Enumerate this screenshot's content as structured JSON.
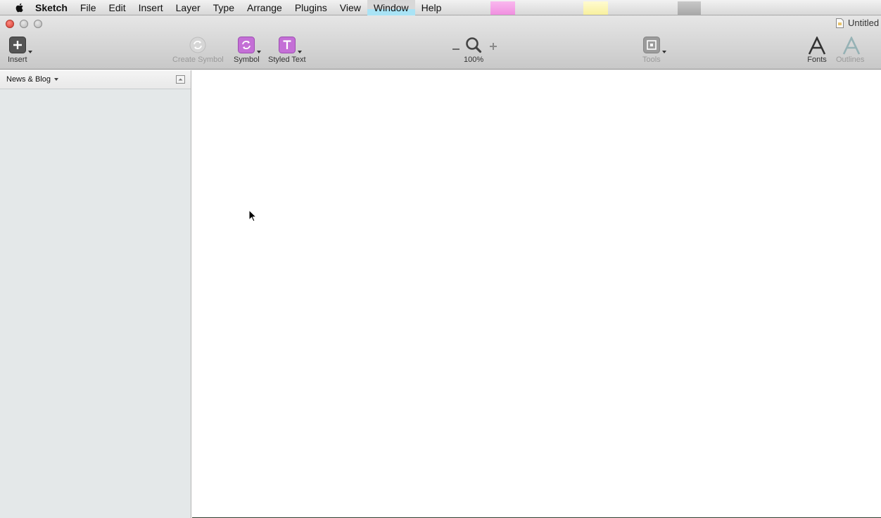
{
  "menubar": {
    "app_name": "Sketch",
    "items": [
      "File",
      "Edit",
      "Insert",
      "Layer",
      "Type",
      "Arrange",
      "Plugins",
      "View",
      "Window",
      "Help"
    ]
  },
  "window": {
    "title": "Untitled"
  },
  "toolbar": {
    "insert_label": "Insert",
    "create_symbol_label": "Create Symbol",
    "symbol_label": "Symbol",
    "styled_text_label": "Styled Text",
    "zoom_level": "100%",
    "tools_label": "Tools",
    "fonts_label": "Fonts",
    "outlines_label": "Outlines"
  },
  "sidebar": {
    "page_name": "News & Blog"
  },
  "colors": {
    "symbol_accent": "#c46fd6",
    "styled_text_accent": "#c46fd6"
  }
}
